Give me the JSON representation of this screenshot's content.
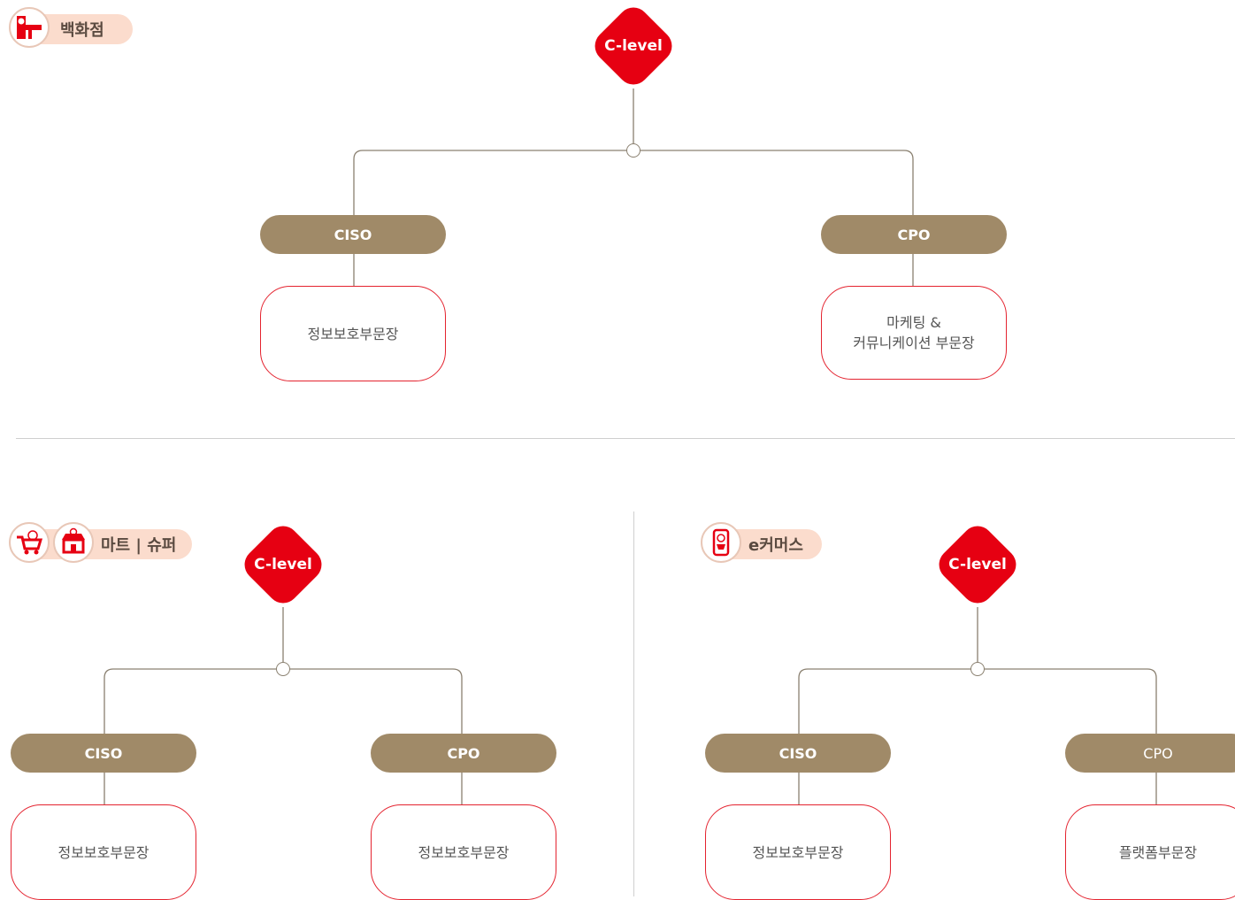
{
  "sections": {
    "department_store": {
      "tag": "백화점",
      "top": "C-level",
      "left_role": "CISO",
      "left_box": "정보보호부문장",
      "right_role": "CPO",
      "right_box_line1": "마케팅 &",
      "right_box_line2": "커뮤니케이션 부문장"
    },
    "mart_super": {
      "tag": "마트 | 슈퍼",
      "top": "C-level",
      "left_role": "CISO",
      "left_box": "정보보호부문장",
      "right_role": "CPO",
      "right_box": "정보보호부문장"
    },
    "ecommerce": {
      "tag": "e커머스",
      "top": "C-level",
      "left_role": "CISO",
      "left_box": "정보보호부문장",
      "right_role": "CPO",
      "right_box": "플랫폼부문장"
    }
  },
  "colors": {
    "accent_red": "#e60012",
    "role_brown": "#a08a68",
    "tag_peach": "#fbdccd",
    "box_border": "#e4232f",
    "connector": "#8a8070"
  },
  "icons": [
    "department-store-icon",
    "cart-icon",
    "storefront-icon",
    "mobile-shop-icon"
  ]
}
